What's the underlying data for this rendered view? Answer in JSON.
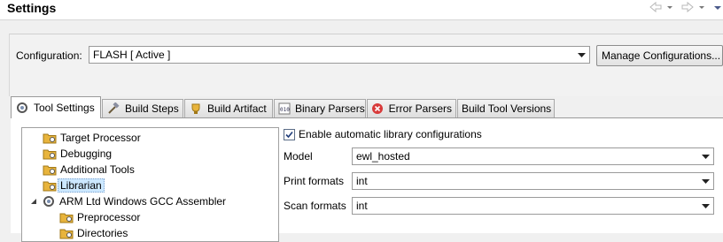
{
  "window": {
    "title": "Settings"
  },
  "configuration": {
    "label": "Configuration:",
    "value": "FLASH  [ Active ]",
    "manage_button": "Manage Configurations..."
  },
  "tabs": [
    {
      "label": "Tool Settings",
      "icon": "gears-icon",
      "active": true
    },
    {
      "label": "Build Steps",
      "icon": "hammer-icon",
      "active": false
    },
    {
      "label": "Build Artifact",
      "icon": "artifact-icon",
      "active": false
    },
    {
      "label": "Binary Parsers",
      "icon": "binary-icon",
      "active": false
    },
    {
      "label": "Error Parsers",
      "icon": "error-icon",
      "active": false
    },
    {
      "label": "Build Tool Versions",
      "icon": "",
      "active": false
    }
  ],
  "tree": [
    {
      "label": "Target Processor",
      "icon": "folder-gear-icon",
      "selected": false
    },
    {
      "label": "Debugging",
      "icon": "folder-gear-icon",
      "selected": false
    },
    {
      "label": "Additional Tools",
      "icon": "folder-gear-icon",
      "selected": false
    },
    {
      "label": "Librarian",
      "icon": "folder-gear-icon",
      "selected": true
    },
    {
      "label": "ARM Ltd Windows GCC Assembler",
      "icon": "gears-icon",
      "expanded": true
    },
    {
      "label": "Preprocessor",
      "icon": "folder-gear-icon",
      "selected": false
    },
    {
      "label": "Directories",
      "icon": "folder-gear-icon",
      "selected": false
    }
  ],
  "library": {
    "enable_label": "Enable automatic library configurations",
    "enable_checked": true,
    "model_label": "Model",
    "model_value": "ewl_hosted",
    "print_label": "Print formats",
    "print_value": "int",
    "scan_label": "Scan formats",
    "scan_value": "int"
  },
  "colors": {
    "selection": "#cce8ff",
    "error_icon": "#d83a3a",
    "folder": "#e8b43c"
  }
}
